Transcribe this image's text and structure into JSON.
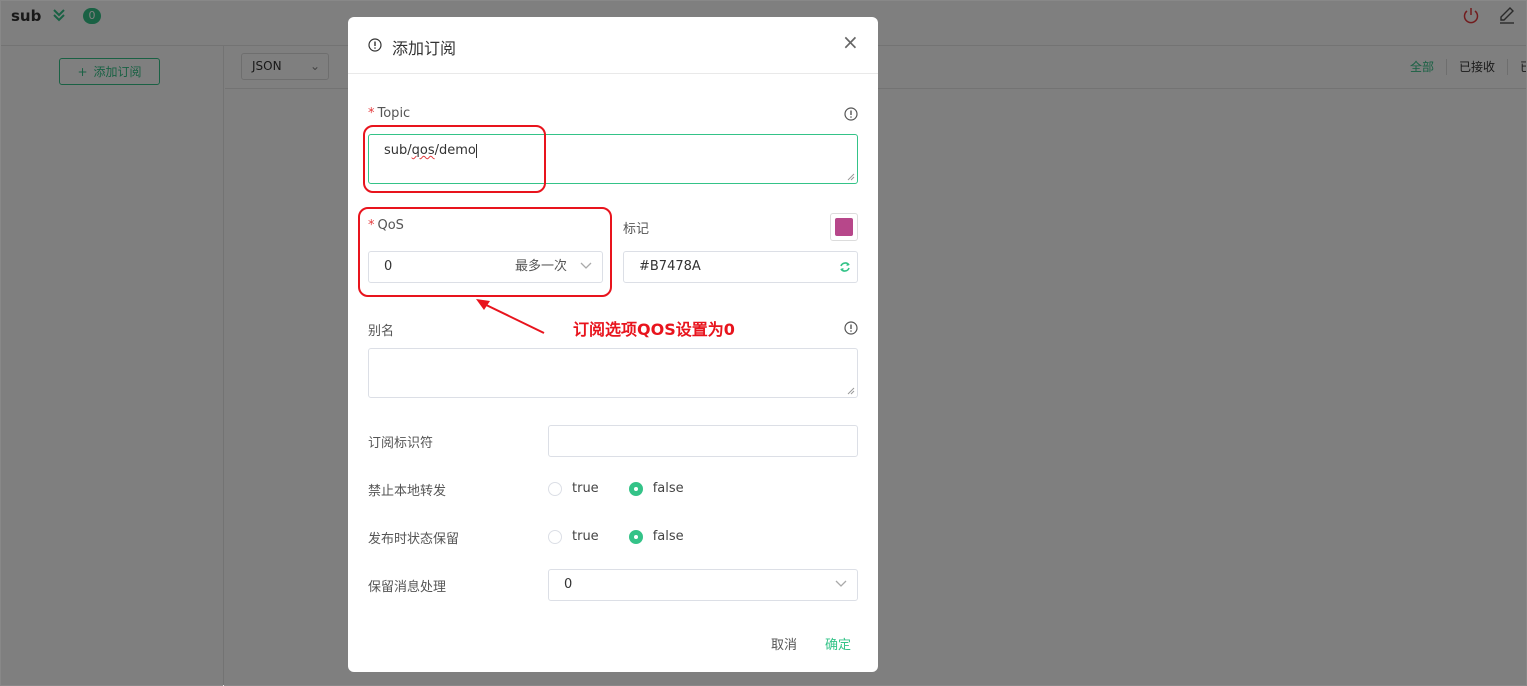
{
  "header": {
    "connection_name": "sub",
    "unread_count": "0"
  },
  "sidebar": {
    "add_subscription_label": "添加订阅"
  },
  "message_bar": {
    "format": "JSON",
    "filters": [
      "全部",
      "已接收",
      "已"
    ]
  },
  "dialog": {
    "title": "添加订阅",
    "topic_label": "Topic",
    "topic_value_parts": [
      "sub/",
      "qos",
      "/demo"
    ],
    "qos_label": "QoS",
    "qos_value": "0",
    "qos_desc": "最多一次",
    "mark_label": "标记",
    "mark_color": "#B7478A",
    "alias_label": "别名",
    "alias_value": "",
    "sub_id_label": "订阅标识符",
    "sub_id_value": "",
    "no_local_label": "禁止本地转发",
    "no_local_options": [
      "true",
      "false"
    ],
    "no_local_selected": "false",
    "rap_label": "发布时状态保留",
    "rap_options": [
      "true",
      "false"
    ],
    "rap_selected": "false",
    "retain_handling_label": "保留消息处理",
    "retain_handling_value": "0",
    "cancel_label": "取消",
    "confirm_label": "确定"
  },
  "annotation": {
    "text": "订阅选项QOS设置为0",
    "color": "#e8141d"
  },
  "colors": {
    "accent": "#34c388",
    "danger": "#e4393c"
  }
}
